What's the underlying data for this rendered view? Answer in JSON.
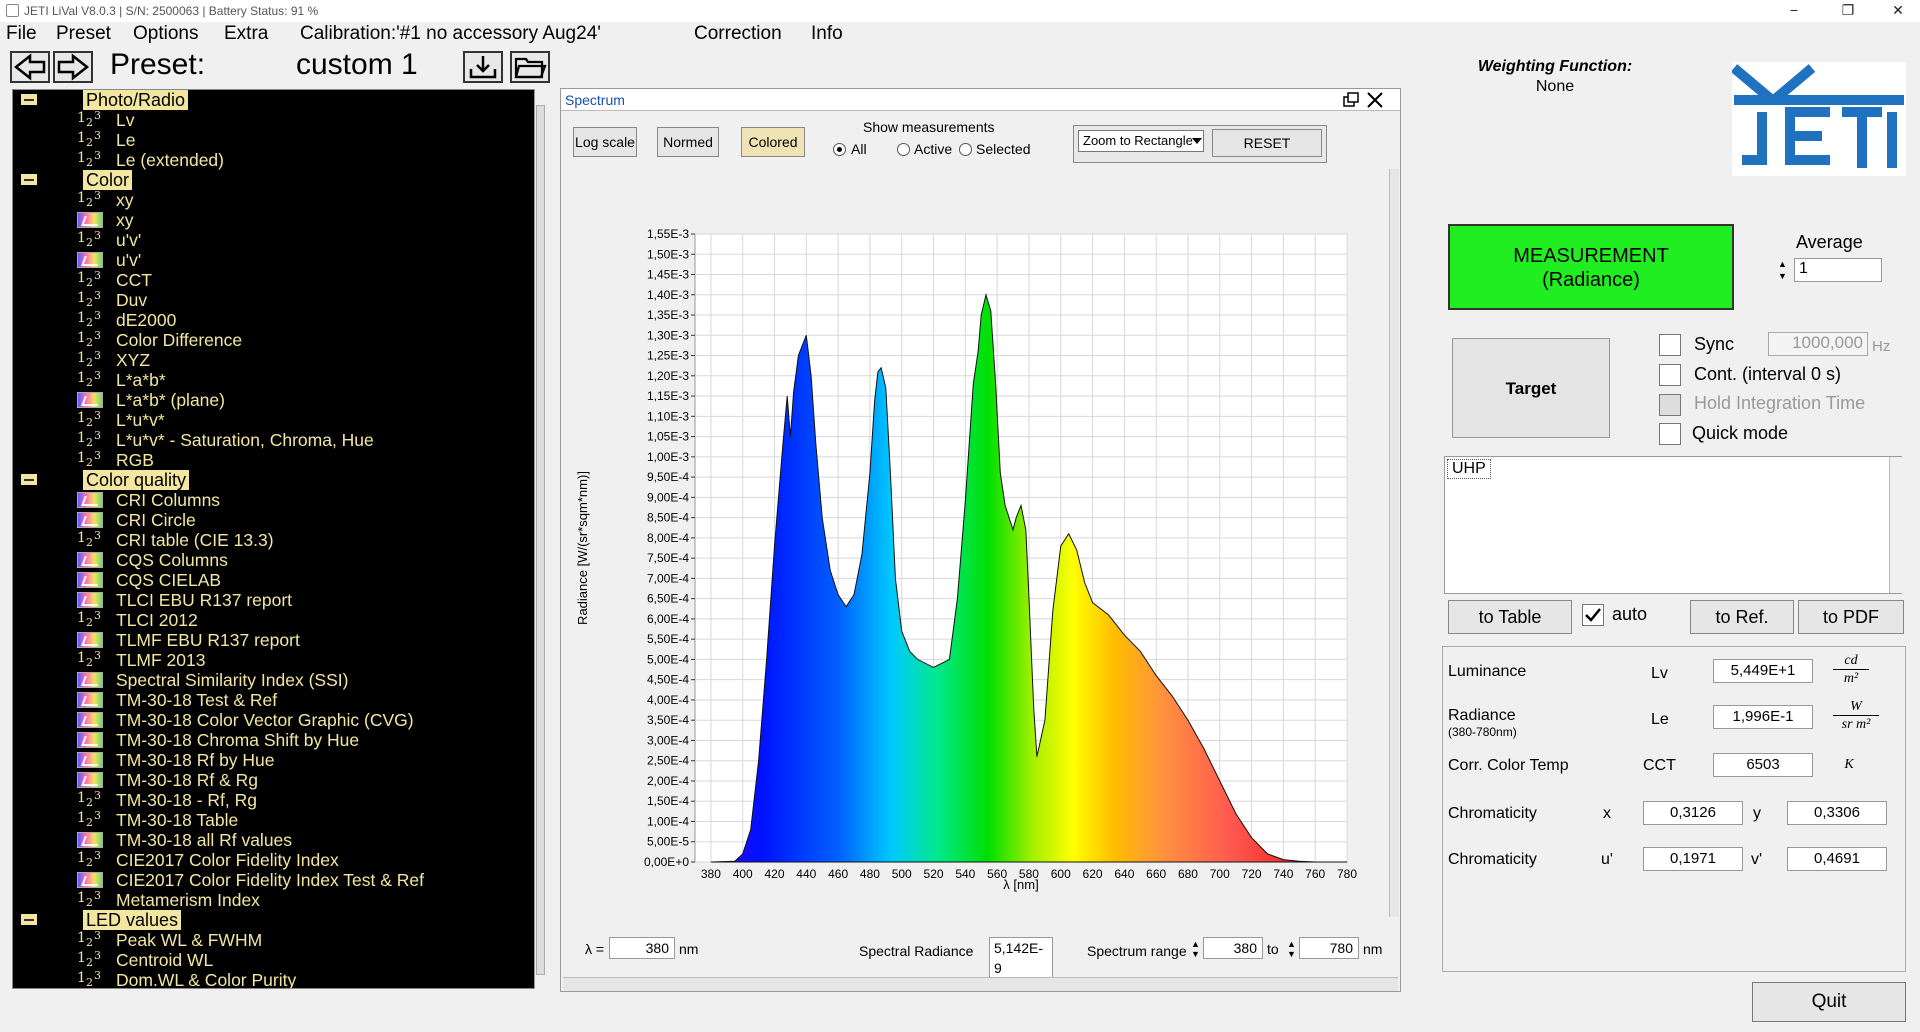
{
  "window": {
    "title": "JETI LiVal V8.0.3 | S/N: 2500063 | Battery Status:  91 %",
    "controls": [
      "−",
      "❐",
      "✕"
    ]
  },
  "menu": {
    "file": "File",
    "preset": "Preset",
    "options": "Options",
    "extra": "Extra",
    "calibration": "Calibration:'#1   no accessory Aug24'",
    "correction": "Correction",
    "info": "Info"
  },
  "preset": {
    "label": "Preset:",
    "value": "custom 1"
  },
  "tree": [
    {
      "type": "cat",
      "label": "Photo/Radio"
    },
    {
      "type": "num",
      "label": "Lv"
    },
    {
      "type": "num",
      "label": "Le"
    },
    {
      "type": "num",
      "label": "Le (extended)"
    },
    {
      "type": "cat",
      "label": "Color"
    },
    {
      "type": "num",
      "label": "xy"
    },
    {
      "type": "grad",
      "label": "xy"
    },
    {
      "type": "num",
      "label": "u'v'"
    },
    {
      "type": "grad",
      "label": "u'v'"
    },
    {
      "type": "num",
      "label": "CCT"
    },
    {
      "type": "num",
      "label": "Duv"
    },
    {
      "type": "num",
      "label": "dE2000"
    },
    {
      "type": "num",
      "label": "Color Difference"
    },
    {
      "type": "num",
      "label": "XYZ"
    },
    {
      "type": "num",
      "label": "L*a*b*"
    },
    {
      "type": "grad",
      "label": "L*a*b* (plane)"
    },
    {
      "type": "num",
      "label": "L*u*v*"
    },
    {
      "type": "num",
      "label": "L*u*v* - Saturation, Chroma, Hue"
    },
    {
      "type": "num",
      "label": "RGB"
    },
    {
      "type": "cat",
      "label": "Color quality"
    },
    {
      "type": "grad",
      "label": "CRI Columns"
    },
    {
      "type": "grad",
      "label": "CRI Circle"
    },
    {
      "type": "num",
      "label": "CRI table (CIE 13.3)"
    },
    {
      "type": "grad",
      "label": "CQS Columns"
    },
    {
      "type": "grad",
      "label": "CQS CIELAB"
    },
    {
      "type": "grad",
      "label": "TLCI EBU R137 report"
    },
    {
      "type": "num",
      "label": "TLCI 2012"
    },
    {
      "type": "grad",
      "label": "TLMF EBU R137 report"
    },
    {
      "type": "num",
      "label": "TLMF 2013"
    },
    {
      "type": "grad",
      "label": "Spectral Similarity Index (SSI)"
    },
    {
      "type": "grad",
      "label": "TM-30-18 Test & Ref"
    },
    {
      "type": "grad",
      "label": "TM-30-18 Color Vector Graphic (CVG)"
    },
    {
      "type": "grad",
      "label": "TM-30-18 Chroma Shift by Hue"
    },
    {
      "type": "grad",
      "label": "TM-30-18 Rf by Hue"
    },
    {
      "type": "grad",
      "label": "TM-30-18 Rf & Rg"
    },
    {
      "type": "num",
      "label": "TM-30-18 - Rf, Rg"
    },
    {
      "type": "num",
      "label": "TM-30-18 Table"
    },
    {
      "type": "grad",
      "label": "TM-30-18 all Rf values"
    },
    {
      "type": "num",
      "label": "CIE2017 Color Fidelity Index"
    },
    {
      "type": "grad",
      "label": "CIE2017 Color Fidelity Index Test & Ref"
    },
    {
      "type": "num",
      "label": "Metamerism Index"
    },
    {
      "type": "cat",
      "label": "LED values"
    },
    {
      "type": "num",
      "label": "Peak WL & FWHM"
    },
    {
      "type": "num",
      "label": "Centroid WL"
    },
    {
      "type": "num",
      "label": "Dom.WL & Color Purity"
    }
  ],
  "spectrum": {
    "title": "Spectrum",
    "log_scale": "Log scale",
    "normed": "Normed",
    "colored": "Colored",
    "show_measurements": "Show measurements",
    "radio_all": "All",
    "radio_active": "Active",
    "radio_selected": "Selected",
    "zoom_mode": "Zoom to Rectangle",
    "reset": "RESET",
    "lambda_label": "λ =",
    "lambda_value": "380",
    "nm": "nm",
    "spectral_radiance_label": "Spectral Radiance",
    "spectral_radiance_value": "5,142E-9",
    "spectrum_range_label": "Spectrum range",
    "range_from": "380",
    "to": "to",
    "range_to": "780"
  },
  "chart_data": {
    "type": "area",
    "xlabel": "λ [nm]",
    "ylabel": "Radiance [W/(sr*sqm*nm)]",
    "xlim": [
      370,
      780
    ],
    "ylim": [
      0,
      0.00155
    ],
    "x_ticks": [
      "380",
      "400",
      "420",
      "440",
      "460",
      "480",
      "500",
      "520",
      "540",
      "560",
      "580",
      "600",
      "620",
      "640",
      "660",
      "680",
      "700",
      "720",
      "740",
      "760",
      "780"
    ],
    "y_ticks": [
      "0,00E+0",
      "5,00E-5",
      "1,00E-4",
      "1,50E-4",
      "2,00E-4",
      "2,50E-4",
      "3,00E-4",
      "3,50E-4",
      "4,00E-4",
      "4,50E-4",
      "5,00E-4",
      "5,50E-4",
      "6,00E-4",
      "6,50E-4",
      "7,00E-4",
      "7,50E-4",
      "8,00E-4",
      "8,50E-4",
      "9,00E-4",
      "9,50E-4",
      "1,00E-3",
      "1,05E-3",
      "1,10E-3",
      "1,15E-3",
      "1,20E-3",
      "1,25E-3",
      "1,30E-3",
      "1,35E-3",
      "1,40E-3",
      "1,45E-3",
      "1,50E-3",
      "1,55E-3"
    ],
    "grid": true,
    "fill": "spectral colors",
    "x": [
      380,
      395,
      400,
      405,
      410,
      415,
      420,
      425,
      428,
      430,
      432,
      435,
      438,
      440,
      443,
      446,
      450,
      455,
      460,
      465,
      470,
      475,
      480,
      483,
      485,
      487,
      490,
      493,
      496,
      500,
      505,
      510,
      520,
      530,
      535,
      540,
      545,
      548,
      550,
      553,
      556,
      559,
      562,
      565,
      570,
      572,
      575,
      578,
      580,
      583,
      585,
      590,
      595,
      600,
      605,
      610,
      615,
      620,
      630,
      640,
      650,
      660,
      670,
      680,
      690,
      700,
      710,
      720,
      730,
      740,
      750,
      760,
      780
    ],
    "y": [
      0,
      2e-06,
      2e-05,
      8e-05,
      0.00025,
      0.0005,
      0.00078,
      0.00102,
      0.00115,
      0.00105,
      0.00116,
      0.00125,
      0.00128,
      0.0013,
      0.0012,
      0.00103,
      0.00085,
      0.00072,
      0.00066,
      0.00063,
      0.00066,
      0.00076,
      0.00096,
      0.00114,
      0.00121,
      0.00122,
      0.00117,
      0.00095,
      0.0007,
      0.00057,
      0.00052,
      0.0005,
      0.00048,
      0.0005,
      0.00065,
      0.00089,
      0.00118,
      0.00126,
      0.00135,
      0.0014,
      0.00136,
      0.00118,
      0.00096,
      0.00088,
      0.00082,
      0.00085,
      0.00088,
      0.00082,
      0.00065,
      0.00038,
      0.00026,
      0.00035,
      0.00062,
      0.00078,
      0.00081,
      0.00077,
      0.00069,
      0.00064,
      0.00061,
      0.00056,
      0.00052,
      0.00046,
      0.00041,
      0.00035,
      0.00028,
      0.0002,
      0.00012,
      6e-05,
      2e-05,
      6e-06,
      2e-06,
      0,
      0
    ]
  },
  "right": {
    "weighting_label": "Weighting Function:",
    "weighting_value": "None",
    "logo_text": "JETI",
    "measurement_line1": "MEASUREMENT",
    "measurement_line2": "(Radiance)",
    "average_label": "Average",
    "average_value": "1",
    "target": "Target",
    "sync_label": "Sync",
    "sync_value": "1000,000",
    "sync_unit": "Hz",
    "cont_label": "Cont. (interval 0 s)",
    "hold_label": "Hold Integration Time",
    "quick_label": "Quick mode",
    "list_item": "UHP",
    "to_table": "to Table",
    "auto": "auto",
    "to_ref": "to Ref.",
    "to_pdf": "to PDF",
    "quit": "Quit"
  },
  "results": {
    "luminance_label": "Luminance",
    "luminance_symbol": "Lv",
    "luminance_value": "5,449E+1",
    "luminance_unit_top": "cd",
    "luminance_unit_bottom": "m²",
    "radiance_label": "Radiance",
    "radiance_sub": "(380-780nm)",
    "radiance_symbol": "Le",
    "radiance_value": "1,996E-1",
    "radiance_unit_top": "W",
    "radiance_unit_bottom": "sr m²",
    "cct_label": "Corr. Color Temp",
    "cct_symbol": "CCT",
    "cct_value": "6503",
    "cct_unit": "K",
    "chroma_label": "Chromaticity",
    "x_symbol": "x",
    "x_value": "0,3126",
    "y_symbol": "y",
    "y_value": "0,3306",
    "chroma2_label": "Chromaticity",
    "u_symbol": "u'",
    "u_value": "0,1971",
    "v_symbol": "v'",
    "v_value": "0,4691"
  },
  "colors": {
    "measure_green": "#21ee21",
    "tree_bg": "#000000",
    "tree_text": "#f2e6a0",
    "logo_blue": "#1f72c0"
  }
}
